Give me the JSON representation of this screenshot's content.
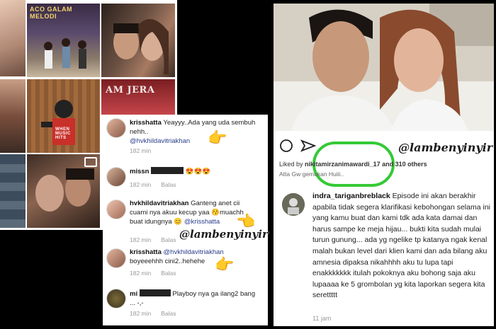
{
  "grid": {
    "tile2_label": "ACO GALAM MELODI",
    "tile5_label": "AM JERA",
    "tile6_label": "WHEN MUSIC HITS"
  },
  "comments": [
    {
      "user": "krisshatta",
      "text": "Yeayyy..Ada yang uda sembuh nehh..",
      "mention": "@hvkhildavitriakhan",
      "time": "182 min",
      "reply": ""
    },
    {
      "user": "missn",
      "text": "😍😍😍",
      "mention": "",
      "time": "182 min",
      "reply": "Balas"
    },
    {
      "user": "hvkhildavitriakhan",
      "text": "Ganteng anet cii cuami nya akuu kecup yaa 😚muachh buat idungnya 😊",
      "mention": "@krisshatta",
      "time": "182 min",
      "reply": "Balas"
    },
    {
      "user": "krisshatta",
      "text": "boyeeehhh cini2..hehehe",
      "mention": "@hvkhildavitriakhan",
      "time": "182 min",
      "reply": "Balas"
    },
    {
      "user": "mi",
      "text": "Playboy nya ga ilang2 bang ... -,-",
      "mention": "",
      "time": "182 min",
      "reply": "Balas"
    }
  ],
  "watermark": "@lambenyinyir",
  "post": {
    "likes_prefix": "Liked by",
    "likes_user": "nikitamirzanimawardi_17",
    "likes_suffix": "and 310 others",
    "caption": "Atta Gw gemukan Huiii..",
    "comment_user": "indra_tariganbreblack",
    "comment_text": "Episode ini akan berakhir apabila tidak segera klarifikasi kebohongan selama ini yang kamu buat dan kami tdk ada kata damai dan harus sampe ke meja hijau... bukti kita sudah mulai turun gunung... ada yg ngelike tp katanya ngak kenal malah bukan level dari klien kami dan ada bilang aku amnesia dipaksa nikahhhh aku tu lupa tapi enakkkkkkk itulah pokoknya aku bohong saja aku lupaaaa ke 5 grombolan yg kita laporkan segera kita serettttt",
    "comment_time": "11 jam"
  },
  "icons": [
    "heart-icon",
    "comment-icon",
    "share-icon",
    "pointing-hand-icon",
    "video-icon"
  ],
  "colors": {
    "accent_circle": "#35c935",
    "mention": "#2a3e8c",
    "meta": "#999999"
  }
}
